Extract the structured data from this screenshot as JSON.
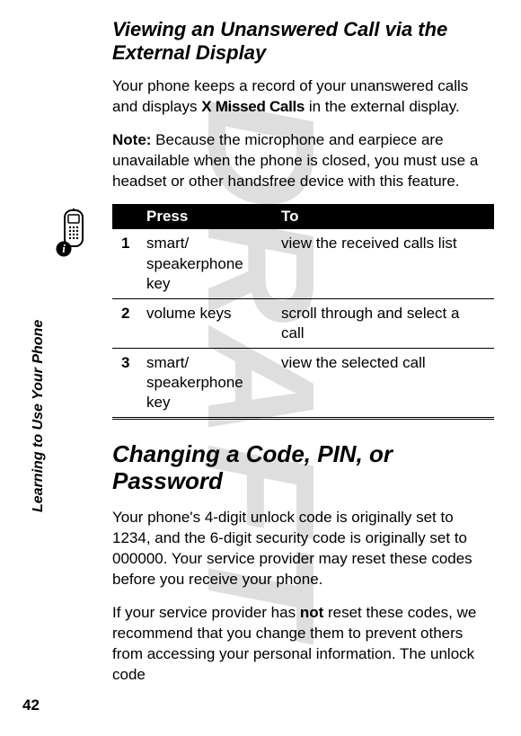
{
  "watermark": "DRAFT",
  "sidebar_label": "Learning to Use Your Phone",
  "page_number": "42",
  "phone_icon": "phone-icon",
  "section1": {
    "heading": "Viewing an Unanswered Call via the External Display",
    "para1_pre": "Your phone keeps a record of your unanswered calls and displays ",
    "para1_bold": "X Missed Calls",
    "para1_post": " in the external display.",
    "para2_label": "Note: ",
    "para2_text": "Because the microphone and earpiece are unavailable when the phone is closed, you must use a headset or other handsfree device with this feature."
  },
  "table": {
    "header_press": "Press",
    "header_to": "To",
    "rows": [
      {
        "num": "1",
        "press": "smart/\nspeakerphone key",
        "to": "view the received calls list"
      },
      {
        "num": "2",
        "press": "volume keys",
        "to": "scroll through and select a call"
      },
      {
        "num": "3",
        "press": "smart/\nspeakerphone key",
        "to": "view the selected call"
      }
    ]
  },
  "section2": {
    "heading": "Changing a Code, PIN, or Password",
    "para1": "Your phone's 4-digit unlock code is originally set to 1234, and the 6-digit security code is originally set to 000000. Your service provider may reset these codes before you receive your phone.",
    "para2_pre": "If your service provider has ",
    "para2_bold": "not",
    "para2_post": " reset these codes, we recommend that you change them to prevent others from accessing your personal information. The unlock code"
  }
}
